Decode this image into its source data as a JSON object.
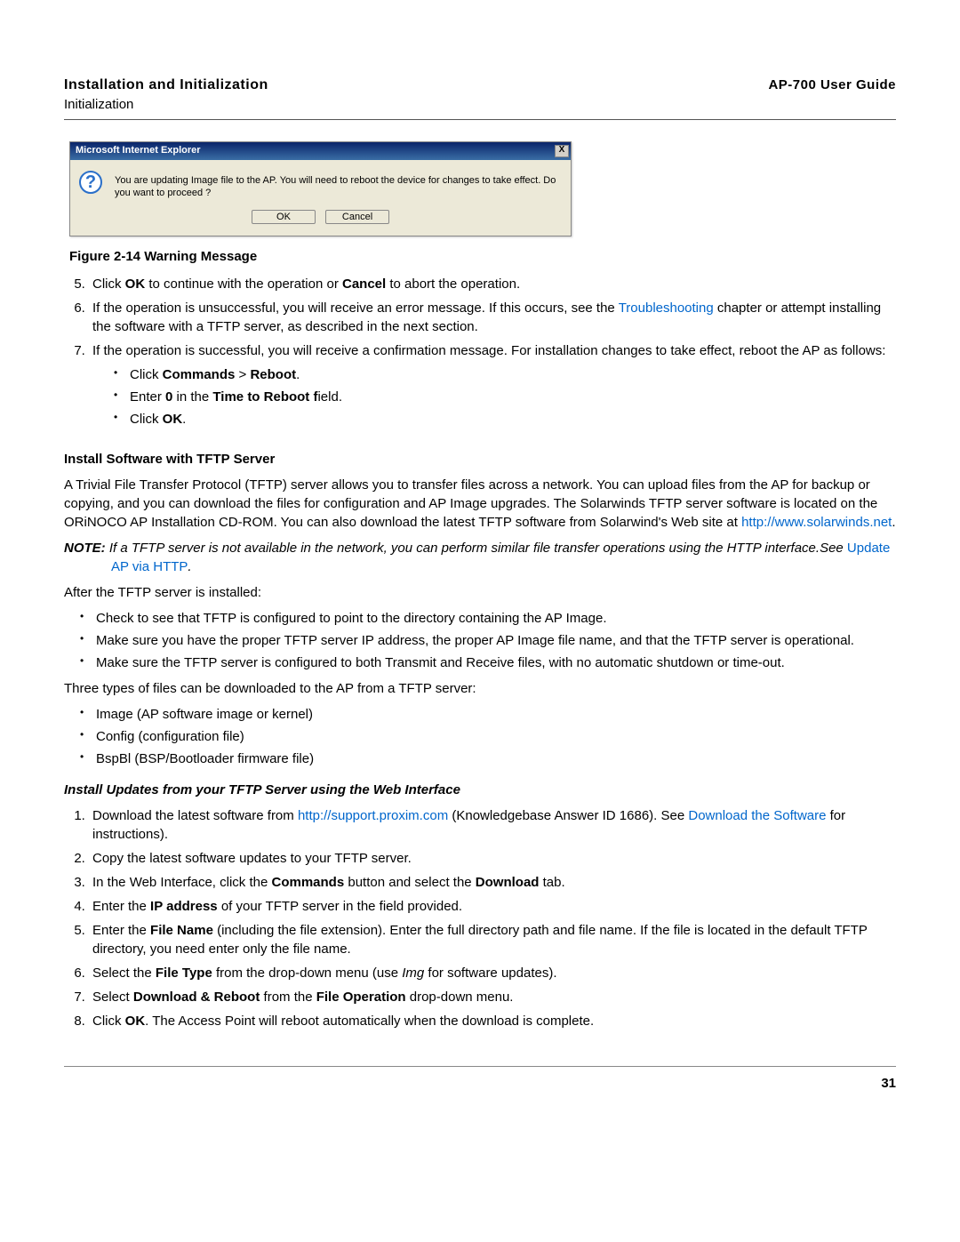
{
  "header": {
    "title": "Installation and Initialization",
    "subtitle": "Initialization",
    "guide": "AP-700 User Guide"
  },
  "dialog": {
    "title": "Microsoft Internet Explorer",
    "close": "X",
    "icon": "?",
    "message": "You are updating Image file to the AP. You will need to reboot the device for changes to take effect. Do you want to proceed ?",
    "ok": "OK",
    "cancel": "Cancel"
  },
  "figcap": "Figure 2-14 Warning Message",
  "step5": {
    "pre": "Click ",
    "ok": "OK",
    "mid": " to continue with the operation or ",
    "cancel": "Cancel",
    "post": " to abort the operation."
  },
  "step6": {
    "a": "If the operation is unsuccessful, you will receive an error message. If this occurs, see the ",
    "link": "Troubleshooting",
    "b": " chapter or attempt installing the software with a TFTP server, as described in the next section."
  },
  "step7": {
    "a": "If the operation is successful, you will receive a confirmation message. For installation changes to take effect, reboot the AP as follows:"
  },
  "step7_sub": {
    "a1": "Click ",
    "a2": "Commands",
    "a3": " > ",
    "a4": "Reboot",
    "a5": ".",
    "b1": "Enter ",
    "b2": "0",
    "b3": " in the ",
    "b4": "Time to Reboot f",
    "b5": "ield.",
    "c1": "Click ",
    "c2": "OK",
    "c3": "."
  },
  "tftp_h": "Install Software with TFTP Server",
  "tftp_p1": {
    "a": "A Trivial File Transfer Protocol (TFTP) server allows you to transfer files across a network. You can upload files from the AP for backup or copying, and you can download the files for configuration and AP Image upgrades. The Solarwinds TFTP server software is located on the ORiNOCO AP Installation CD-ROM. You can also download the latest TFTP software from Solarwind's Web site at ",
    "link": "http://www.solarwinds.net",
    "b": "."
  },
  "note": {
    "label": "NOTE: ",
    "a": "If a TFTP server is not available in the network, you can perform similar file transfer operations using the HTTP interface.See ",
    "link": "Update AP via HTTP",
    "b": "."
  },
  "after": "After the TFTP server is installed:",
  "checks": {
    "c1": "Check to see that TFTP is configured to point to the directory containing the AP Image.",
    "c2": "Make sure you have the proper TFTP server IP address, the proper AP Image file name, and that the TFTP server is operational.",
    "c3": "Make sure the TFTP server is configured to both Transmit and Receive files, with no automatic shutdown or time-out."
  },
  "three": "Three types of files can be downloaded to the AP from a TFTP server:",
  "types": {
    "t1": "Image (AP software image or kernel)",
    "t2": "Config (configuration file)",
    "t3": "BspBl (BSP/Bootloader firmware file)"
  },
  "web_h": "Install Updates from your TFTP Server using the Web Interface",
  "web_steps": {
    "s1a": "Download the latest software from ",
    "s1link1": "http://support.proxim.com",
    "s1b": " (Knowledgebase Answer ID 1686). See ",
    "s1link2": "Download the Software",
    "s1c": " for instructions).",
    "s2": "Copy the latest software updates to your TFTP server.",
    "s3a": "In the Web Interface, click the ",
    "s3b": "Commands",
    "s3c": " button and select the ",
    "s3d": "Download",
    "s3e": " tab.",
    "s4a": "Enter the ",
    "s4b": "IP address",
    "s4c": " of your TFTP server in the field provided.",
    "s5a": "Enter the ",
    "s5b": "File Name",
    "s5c": " (including the file extension). Enter the full directory path and file name. If the file is located in the default TFTP directory, you need enter only the file name.",
    "s6a": "Select the ",
    "s6b": "File Type",
    "s6c": " from the drop-down menu (use ",
    "s6d": "Img",
    "s6e": " for software updates).",
    "s7a": "Select ",
    "s7b": "Download & Reboot",
    "s7c": " from the ",
    "s7d": "File Operation",
    "s7e": " drop-down menu.",
    "s8a": "Click ",
    "s8b": "OK",
    "s8c": ". The Access Point will reboot automatically when the download is complete."
  },
  "pagenum": "31"
}
